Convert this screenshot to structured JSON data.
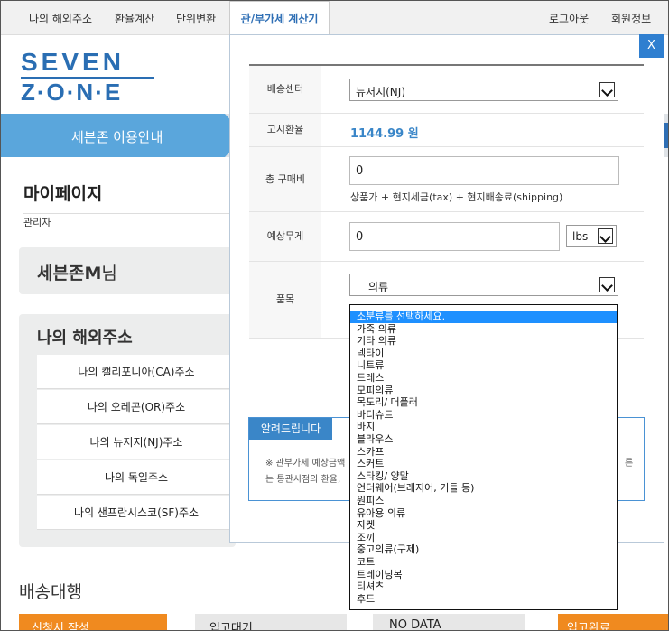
{
  "topnav": {
    "items": [
      "나의 해외주소",
      "환율계산",
      "단위변환"
    ],
    "active": "관/부가세 계산기",
    "right": [
      "로그아웃",
      "회원정보"
    ]
  },
  "logo": {
    "line1": "SEVEN",
    "line2": "Z·O·N·E"
  },
  "banner": {
    "text": "세븐존 이용안내"
  },
  "mypage": {
    "title": "마이페이지",
    "role": "관리자",
    "user": "세븐존M",
    "user_suffix": "님"
  },
  "address": {
    "title": "나의 해외주소",
    "rows": [
      "나의 캘리포니아(CA)주소",
      "나의 오레곤(OR)주소",
      "나의 뉴저지(NJ)주소",
      "나의 독일주소",
      "나의 샌프란시스코(SF)주소"
    ]
  },
  "delivery": {
    "title": "배송대행",
    "buttons": [
      "신청서 작성",
      "입고대기",
      "NO DATA",
      "입고완료"
    ]
  },
  "modal": {
    "close": "X",
    "fields": {
      "center_label": "배송센터",
      "center_value": "뉴저지(NJ)",
      "rate_label": "고시환율",
      "rate_value": "1144.99 원",
      "total_label": "총 구매비",
      "total_value": "0",
      "total_hint": "상품가 + 현지세금(tax) + 현지배송료(shipping)",
      "weight_label": "예상무게",
      "weight_value": "0",
      "weight_unit": "lbs",
      "item_label": "품목",
      "item_value": "의류"
    },
    "notice": {
      "tab": "알려드립니다",
      "line1": "※ 관부가세 예상금액",
      "line2": "는 통관시점의 환율,",
      "line3": "른"
    },
    "dropdown_options": [
      "소분류를 선택하세요.",
      "가죽 의류",
      "기타 의류",
      "넥타이",
      "니트류",
      "드레스",
      "모피의류",
      "목도리/ 머플러",
      "바디슈트",
      "바지",
      "블라우스",
      "스카프",
      "스커트",
      "스타킹/ 양말",
      "언더웨어(브래지어, 거들 등)",
      "원피스",
      "유아용 의류",
      "자켓",
      "조끼",
      "중고의류(구제)",
      "코트",
      "트레이닝복",
      "티셔츠",
      "후드"
    ],
    "dropdown_selected_index": 0
  },
  "colors": {
    "brand": "#2a6eb3",
    "accent": "#3a86c8",
    "orange": "#f08a1f",
    "highlight": "#1e90ff"
  }
}
